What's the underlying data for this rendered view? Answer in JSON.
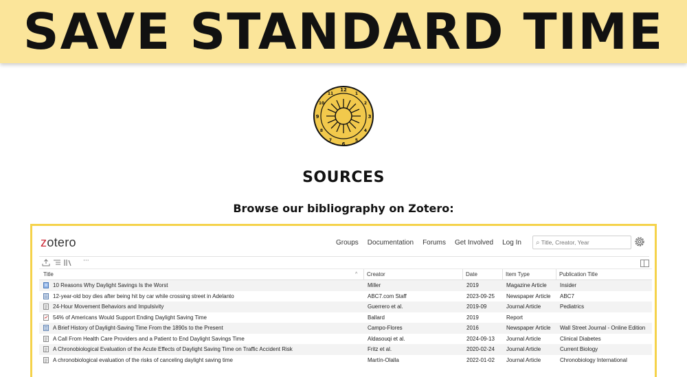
{
  "banner": {
    "title": "SAVE STANDARD TIME"
  },
  "logo": {
    "numerals": {
      "top": "12",
      "right": "3",
      "bottom": "6",
      "left": "9",
      "r1": "1",
      "r2": "2",
      "r4": "4",
      "r5": "5",
      "l7": "7",
      "l8": "8",
      "l10": "10",
      "l11": "11"
    }
  },
  "sources": {
    "heading": "SOURCES",
    "browse_label": "Browse our bibliography on Zotero:"
  },
  "zotero": {
    "brand_prefix": "z",
    "brand_rest": "otero",
    "nav": [
      "Groups",
      "Documentation",
      "Forums",
      "Get Involved",
      "Log In"
    ],
    "search_placeholder": "Title, Creator, Year",
    "toolbar_more": "···",
    "columns": {
      "title": "Title",
      "creator": "Creator",
      "date": "Date",
      "item_type": "Item Type",
      "publication": "Publication Title"
    },
    "rows": [
      {
        "icon": "magazine-icon",
        "title": "10 Reasons Why Daylight Savings Is the Worst",
        "creator": "Miller",
        "date": "2019",
        "item_type": "Magazine Article",
        "publication": "Insider"
      },
      {
        "icon": "newspaper-icon",
        "title": "12-year-old boy dies after being hit by car while crossing street in Adelanto",
        "creator": "ABC7.com Staff",
        "date": "2023-09-25",
        "item_type": "Newspaper Article",
        "publication": "ABC7"
      },
      {
        "icon": "journal-icon",
        "title": "24-Hour Movement Behaviors and Impulsivity",
        "creator": "Guerrero et al.",
        "date": "2019-09",
        "item_type": "Journal Article",
        "publication": "Pediatrics"
      },
      {
        "icon": "report-icon",
        "title": "54% of Americans Would Support Ending Daylight Saving Time",
        "creator": "Ballard",
        "date": "2019",
        "item_type": "Report",
        "publication": ""
      },
      {
        "icon": "newspaper-icon",
        "title": "A Brief History of Daylight-Saving Time From the 1890s to the Present",
        "creator": "Campo-Flores",
        "date": "2016",
        "item_type": "Newspaper Article",
        "publication": "Wall Street Journal - Online Edition"
      },
      {
        "icon": "journal-icon",
        "title": "A Call From Health Care Providers and a Patient to End Daylight Savings Time",
        "creator": "Aldasouqi et al.",
        "date": "2024-09-13",
        "item_type": "Journal Article",
        "publication": "Clinical Diabetes"
      },
      {
        "icon": "journal-icon",
        "title": "A Chronobiological Evaluation of the Acute Effects of Daylight Saving Time on Traffic Accident Risk",
        "creator": "Fritz et al.",
        "date": "2020-02-24",
        "item_type": "Journal Article",
        "publication": "Current Biology"
      },
      {
        "icon": "journal-icon",
        "title": "A chronobiological evaluation of the risks of canceling daylight saving time",
        "creator": "Martín-Olalla",
        "date": "2022-01-02",
        "item_type": "Journal Article",
        "publication": "Chronobiology International"
      }
    ]
  },
  "colors": {
    "banner_bg": "#fbe59a",
    "frame_border": "#f5d24a",
    "zotero_red": "#cc2936",
    "logo_gold": "#f2c94c"
  }
}
